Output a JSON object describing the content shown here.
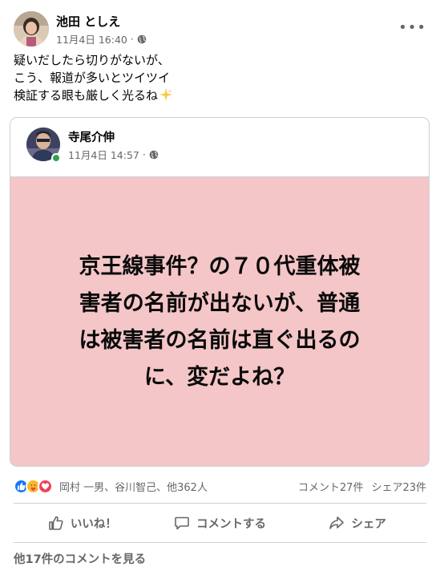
{
  "post": {
    "author": "池田 としえ",
    "date": "11月4日 16:40",
    "separator": "·",
    "text_lines": [
      "疑いだしたら切りがないが、",
      "こう、報道が多いとツイツイ",
      "検証する眼も厳しく光るね"
    ],
    "icons": {
      "privacy": "globe-icon",
      "more": "more-options-icon",
      "emoji": "sparkle-emoji"
    },
    "more_label": "•••"
  },
  "shared_post": {
    "author": "寺尾介伸",
    "date": "11月4日 14:57",
    "separator": "·",
    "card_lines": [
      "京王線事件？の７０代重体被",
      "害者の名前が出ないが、普通",
      "は被害者の名前は直ぐ出るの",
      "に、変だよね？"
    ],
    "card_color": "#f4c6c8",
    "online_color": "#31a24c"
  },
  "reactions": {
    "types": [
      "like",
      "care",
      "love"
    ],
    "names": "岡村 一男、谷川智己、他362人",
    "comments": "コメント27件",
    "shares": "シェア23件"
  },
  "actions": {
    "like": "いいね！",
    "comment": "コメントする",
    "share": "シェア"
  },
  "view_comments": "他17件のコメントを見る",
  "colors": {
    "like_blue": "#1877f2",
    "secondary_text": "#65676b",
    "divider": "#ced0d4"
  }
}
